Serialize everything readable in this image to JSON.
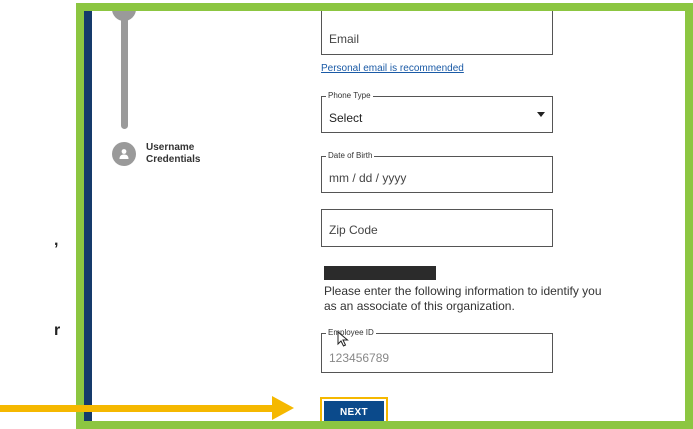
{
  "stepper": {
    "current_step_label": "Username\nCredentials"
  },
  "form": {
    "email": {
      "value": "Email"
    },
    "email_hint": "Personal email is recommended",
    "phone_type": {
      "legend": "Phone Type",
      "value": "Select"
    },
    "dob": {
      "legend": "Date of Birth",
      "placeholder": "mm / dd / yyyy"
    },
    "zip": {
      "value": "Zip Code"
    },
    "info_text": "Please enter the following information to identify you as an associate of this organization.",
    "employee_id": {
      "legend": "Employee ID",
      "placeholder": "123456789"
    },
    "next_label": "NEXT"
  },
  "left_fragments": [
    ",",
    "r"
  ],
  "colors": {
    "frame_border": "#8cc641",
    "navy": "#153a6b",
    "button": "#0b4a8b",
    "highlight": "#f5b800",
    "link": "#1a5aa6"
  },
  "icons": [
    "user-icon",
    "arrow-right-icon",
    "mouse-cursor-icon",
    "chevron-down-icon"
  ]
}
